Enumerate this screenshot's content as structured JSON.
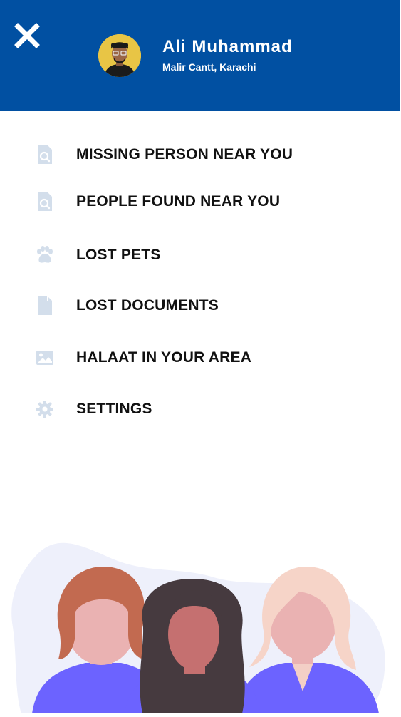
{
  "header": {
    "user_name": "Ali Muhammad",
    "user_location": "Malir Cantt, Karachi",
    "brand_color": "#0150a2"
  },
  "menu": {
    "icon_color": "#d3deeb",
    "items": [
      {
        "label": "MISSING PERSON NEAR YOU",
        "icon": "file-search-icon"
      },
      {
        "label": "PEOPLE FOUND NEAR YOU",
        "icon": "file-search-icon"
      },
      {
        "label": "LOST PETS",
        "icon": "paw-icon"
      },
      {
        "label": "LOST DOCUMENTS",
        "icon": "document-icon"
      },
      {
        "label": "HALAAT IN YOUR AREA",
        "icon": "image-icon"
      },
      {
        "label": "SETTINGS",
        "icon": "gear-icon"
      }
    ]
  }
}
